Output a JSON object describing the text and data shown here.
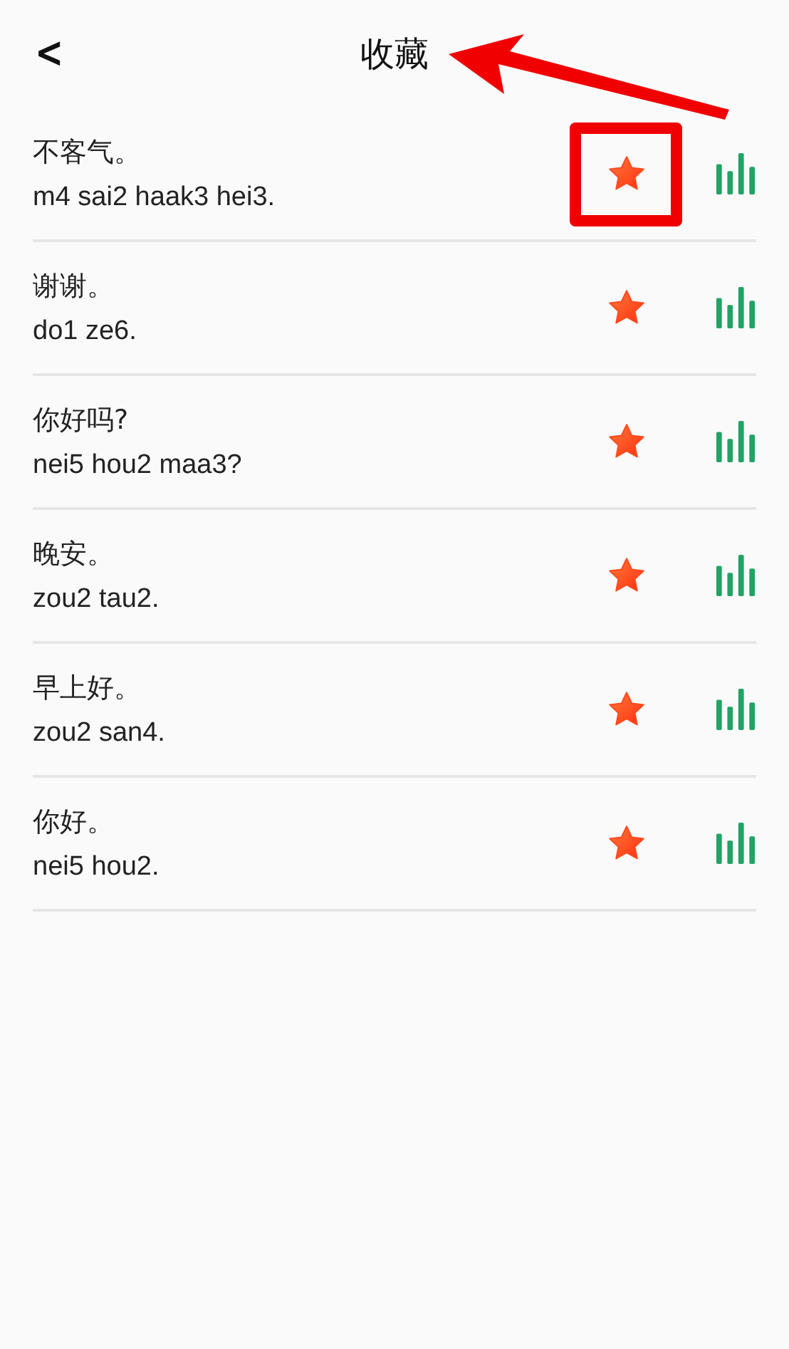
{
  "header": {
    "back": "<",
    "title": "收藏"
  },
  "items": [
    {
      "text": "不客气。",
      "romanization": "m4 sai2 haak3 hei3.",
      "favorited": true,
      "highlighted": true
    },
    {
      "text": "谢谢。",
      "romanization": "do1 ze6.",
      "favorited": true,
      "highlighted": false
    },
    {
      "text": "你好吗?",
      "romanization": "nei5 hou2 maa3?",
      "favorited": true,
      "highlighted": false
    },
    {
      "text": "晚安。",
      "romanization": "zou2 tau2.",
      "favorited": true,
      "highlighted": false
    },
    {
      "text": "早上好。",
      "romanization": "zou2 san4.",
      "favorited": true,
      "highlighted": false
    },
    {
      "text": "你好。",
      "romanization": "nei5 hou2.",
      "favorited": true,
      "highlighted": false
    }
  ],
  "annotation_arrow": true
}
